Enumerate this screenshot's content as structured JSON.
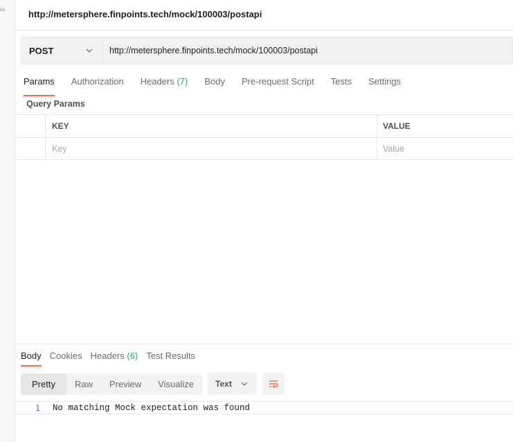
{
  "app": {
    "rail_glyph": "∞",
    "accent_color": "#ff6c37",
    "count_color": "#0cbb52"
  },
  "request": {
    "title": "http://metersphere.finpoints.tech/mock/100003/postapi",
    "method": "POST",
    "url": "http://metersphere.finpoints.tech/mock/100003/postapi"
  },
  "request_tabs": [
    {
      "label": "Params",
      "count": ""
    },
    {
      "label": "Authorization",
      "count": ""
    },
    {
      "label": "Headers ",
      "count": "(7)"
    },
    {
      "label": "Body",
      "count": ""
    },
    {
      "label": "Pre-request Script",
      "count": ""
    },
    {
      "label": "Tests",
      "count": ""
    },
    {
      "label": "Settings",
      "count": ""
    }
  ],
  "query_params": {
    "section_label": "Query Params",
    "columns": [
      "KEY",
      "VALUE"
    ],
    "placeholder_row": {
      "key": "Key",
      "value": "Value"
    }
  },
  "response_tabs": [
    {
      "label": "Body",
      "count": ""
    },
    {
      "label": "Cookies",
      "count": ""
    },
    {
      "label": "Headers ",
      "count": "(6)"
    },
    {
      "label": "Test Results",
      "count": ""
    }
  ],
  "view_modes": [
    "Pretty",
    "Raw",
    "Preview",
    "Visualize"
  ],
  "format": "Text",
  "body_lines": [
    {
      "no": "1",
      "text": "No matching Mock expectation was found"
    }
  ],
  "icons": {
    "method_dropdown": "chevron-down-icon",
    "format_dropdown": "chevron-down-icon",
    "wrap": "wrap-lines-icon"
  }
}
